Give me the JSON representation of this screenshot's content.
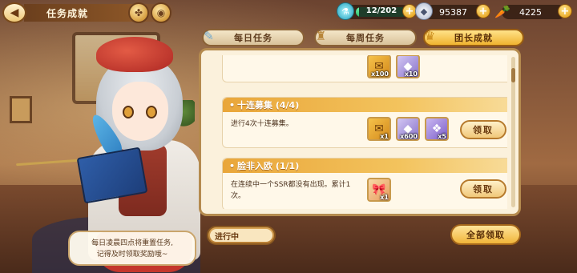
{
  "header": {
    "back_icon": "back-arrow-icon",
    "title": "任务成就"
  },
  "currency": {
    "stamina": {
      "text": "12/202",
      "fill": 0.06,
      "icon": "potion-icon"
    },
    "gems": {
      "text": "95387",
      "icon": "gem-icon"
    },
    "carrots": {
      "text": "4225",
      "icon": "carrot-icon"
    }
  },
  "tabs": [
    {
      "label": "每日任务",
      "icon": "feather-icon",
      "active": false
    },
    {
      "label": "每周任务",
      "icon": "trophy-icon",
      "active": false
    },
    {
      "label": "团长成就",
      "icon": "crown-cup-icon",
      "active": true
    }
  ],
  "tasks": [
    {
      "title": "",
      "desc": "",
      "rewards": [
        {
          "icon": "ticket-icon",
          "qty": "x100"
        },
        {
          "icon": "gem-icon",
          "qty": "x10"
        }
      ],
      "claim_label": ""
    },
    {
      "title": "十连募集 (4/4)",
      "desc": "进行4次十连募集。",
      "rewards": [
        {
          "icon": "ticket-icon",
          "qty": "x1"
        },
        {
          "icon": "gem-icon",
          "qty": "x600"
        },
        {
          "icon": "crystal-icon",
          "qty": "x5"
        }
      ],
      "claim_label": "领取"
    },
    {
      "title": "脸非入欧 (1/1)",
      "desc": "在连续中一个SSR都没有出现。累计1次。",
      "rewards": [
        {
          "icon": "bow-gift-icon",
          "qty": "x1"
        }
      ],
      "claim_label": "领取"
    }
  ],
  "footer": {
    "speech_line1": "每日凌晨四点将重置任务,",
    "speech_line2": "记得及时领取奖励哦~",
    "status": "进行中",
    "claim_all": "全部领取"
  }
}
